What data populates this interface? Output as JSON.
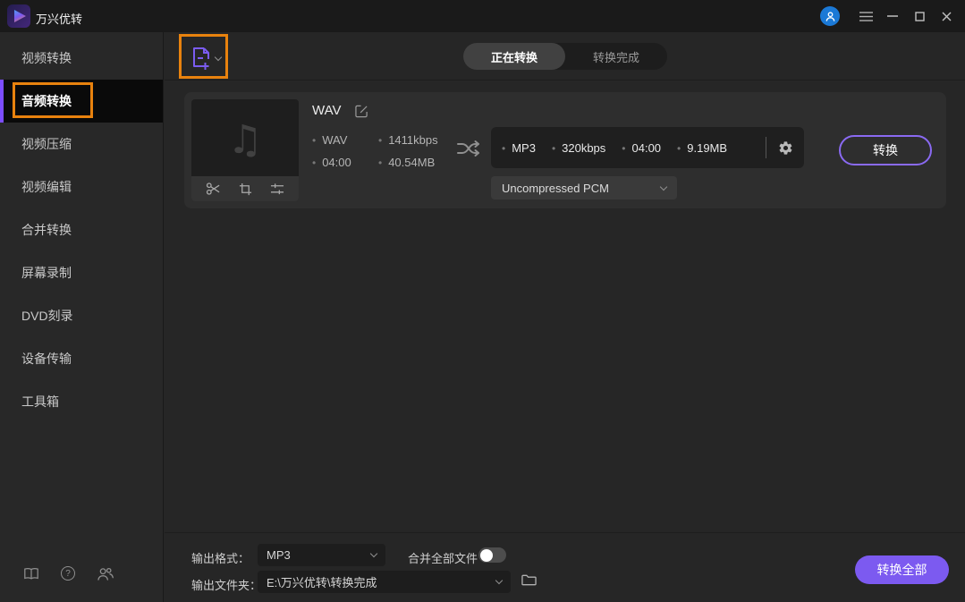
{
  "app": {
    "title": "万兴优转"
  },
  "sidebar": {
    "items": [
      {
        "label": "视频转换",
        "active": false
      },
      {
        "label": "音频转换",
        "active": true
      },
      {
        "label": "视频压缩",
        "active": false
      },
      {
        "label": "视频编辑",
        "active": false
      },
      {
        "label": "合并转换",
        "active": false
      },
      {
        "label": "屏幕录制",
        "active": false
      },
      {
        "label": "DVD刻录",
        "active": false
      },
      {
        "label": "设备传输",
        "active": false
      },
      {
        "label": "工具箱",
        "active": false
      }
    ]
  },
  "tabs": [
    {
      "label": "正在转换",
      "active": true
    },
    {
      "label": "转换完成",
      "active": false
    }
  ],
  "file_card": {
    "title": "WAV",
    "source": {
      "format": "WAV",
      "bitrate": "1411kbps",
      "duration": "04:00",
      "size": "40.54MB"
    },
    "target": {
      "format": "MP3",
      "bitrate": "320kbps",
      "duration": "04:00",
      "size": "9.19MB"
    },
    "codec": "Uncompressed PCM",
    "convert_label": "转换"
  },
  "footer": {
    "format_label": "输出格式：",
    "format_value": "MP3",
    "merge_label": "合并全部文件",
    "merge_on": false,
    "folder_label": "输出文件夹：",
    "folder_value": "E:\\万兴优转\\转换完成",
    "convert_all_label": "转换全部"
  },
  "icons": {
    "music_note": "♫",
    "help_glyph": "?"
  },
  "colors": {
    "accent_purple": "#7c5af0",
    "annotation_orange": "#e8820e",
    "avatar_blue": "#1b79d6",
    "active_item_bg": "#0a0a0a"
  }
}
